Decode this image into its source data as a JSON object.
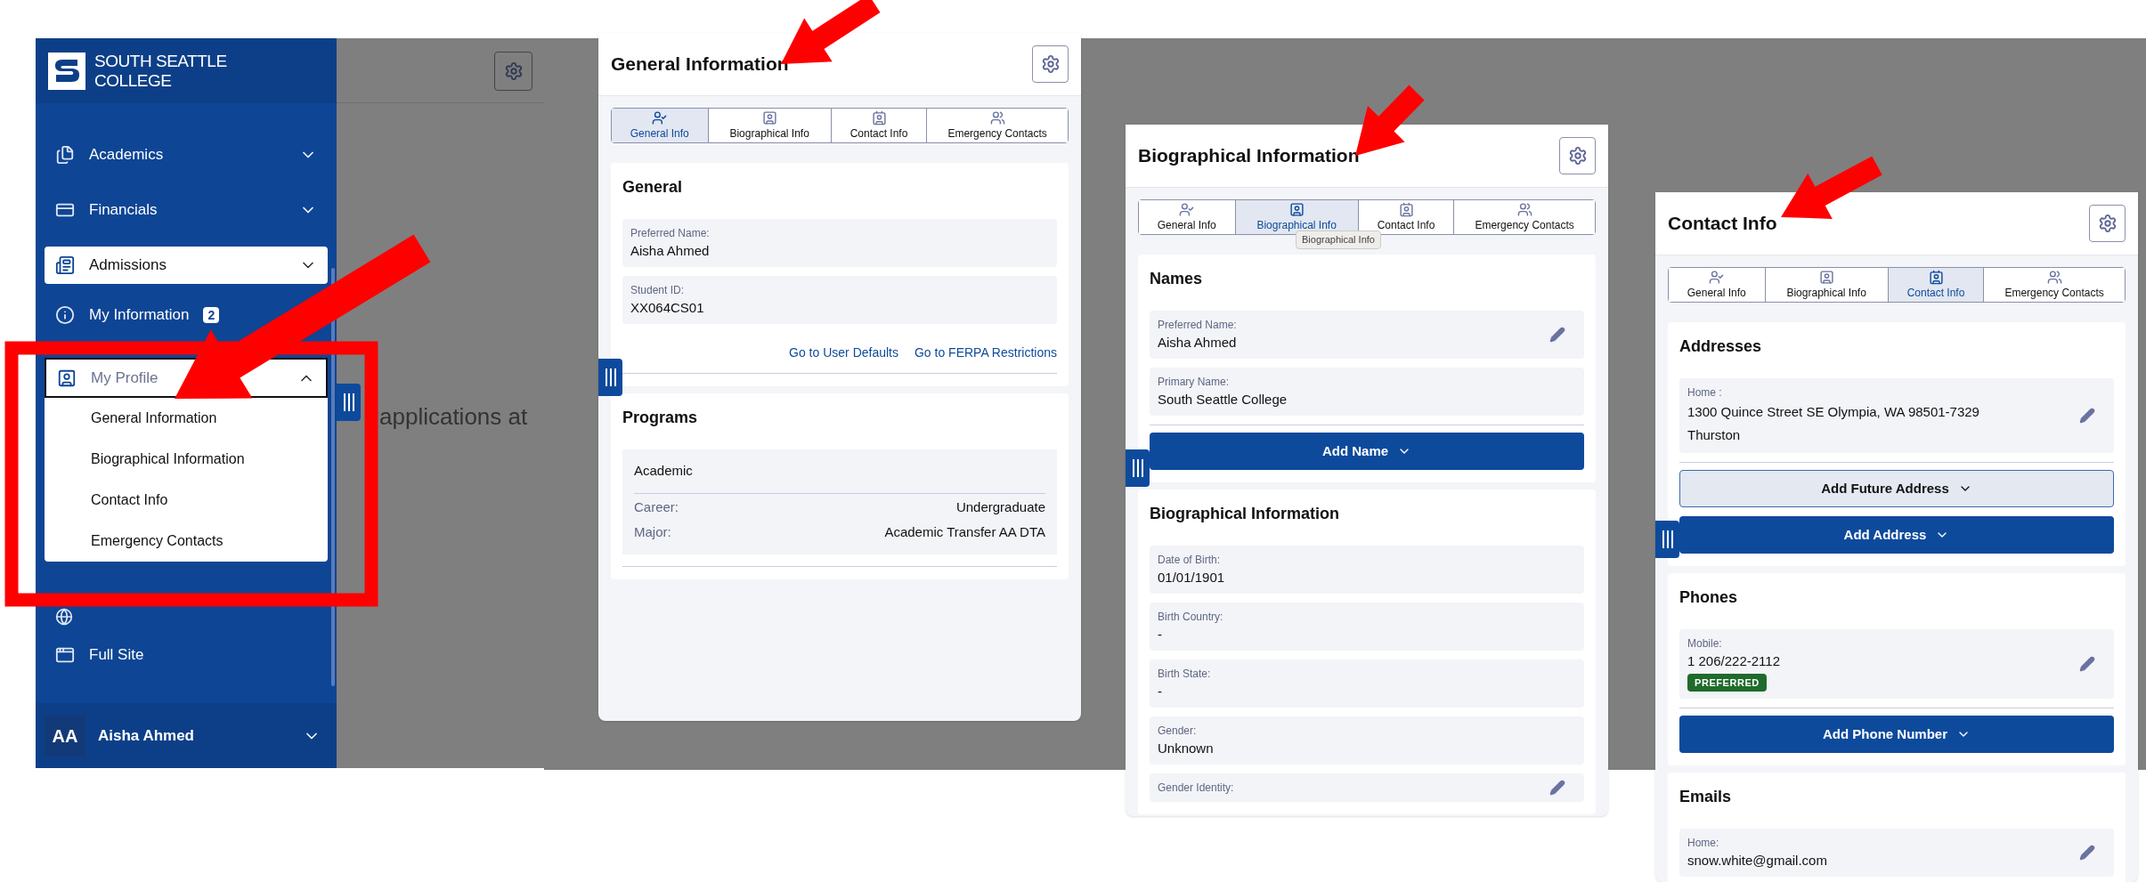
{
  "sidebar_screen": {
    "logo_lines": [
      "SOUTH SEATTLE",
      "COLLEGE"
    ],
    "nav": [
      {
        "label": "Academics",
        "selected": false,
        "expanded": false
      },
      {
        "label": "Financials",
        "selected": false,
        "expanded": false
      },
      {
        "label": "Admissions",
        "selected": true,
        "expanded": false
      },
      {
        "label": "My Information",
        "badge": "2",
        "selected": false
      },
      {
        "label": "My Profile",
        "selected": false,
        "expanded": true,
        "children": [
          {
            "label": "General Information"
          },
          {
            "label": "Biographical Information"
          },
          {
            "label": "Contact Info"
          },
          {
            "label": "Emergency Contacts"
          }
        ]
      },
      {
        "selected": false
      },
      {
        "label": "Full Site",
        "selected": false
      }
    ],
    "user": {
      "initials": "AA",
      "name": "Aisha Ahmed"
    },
    "content_text": "applications at"
  },
  "panels": [
    {
      "title": "General Information",
      "tabs": [
        {
          "label": "General Info",
          "selected": true
        },
        {
          "label": "Biographical Info",
          "selected": false
        },
        {
          "label": "Contact Info",
          "selected": false
        },
        {
          "label": "Emergency Contacts",
          "selected": false
        }
      ],
      "sections": [
        {
          "heading": "General",
          "items": [
            {
              "kind": "field",
              "label": "Preferred Name:",
              "value": "Aisha Ahmed",
              "editable": false
            },
            {
              "kind": "field",
              "label": "Student ID:",
              "value": "XX064CS01",
              "editable": false
            },
            {
              "kind": "links",
              "links": [
                "Go to User Defaults",
                "Go to FERPA Restrictions"
              ]
            }
          ]
        },
        {
          "heading": "Programs",
          "items": [
            {
              "kind": "program",
              "title": "Academic",
              "rows": [
                {
                  "label": "Career:",
                  "value": "Undergraduate"
                },
                {
                  "label": "Major:",
                  "value": "Academic Transfer AA DTA"
                }
              ]
            }
          ]
        }
      ]
    },
    {
      "title": "Biographical Information",
      "tooltip": "Biographical Info",
      "tabs": [
        {
          "label": "General Info",
          "selected": false
        },
        {
          "label": "Biographical Info",
          "selected": true
        },
        {
          "label": "Contact Info",
          "selected": false
        },
        {
          "label": "Emergency Contacts",
          "selected": false
        }
      ],
      "sections": [
        {
          "heading": "Names",
          "items": [
            {
              "kind": "field",
              "label": "Preferred Name:",
              "value": "Aisha Ahmed",
              "editable": true
            },
            {
              "kind": "field",
              "label": "Primary Name:",
              "value": "South Seattle College",
              "editable": false
            },
            {
              "kind": "button",
              "label": "Add Name"
            }
          ]
        },
        {
          "heading": "Biographical Information",
          "items": [
            {
              "kind": "field",
              "label": "Date of Birth:",
              "value": "01/01/1901",
              "editable": false
            },
            {
              "kind": "field",
              "label": "Birth Country:",
              "value": "-",
              "editable": false
            },
            {
              "kind": "field",
              "label": "Birth State:",
              "value": "-",
              "editable": false
            },
            {
              "kind": "field",
              "label": "Gender:",
              "value": "Unknown",
              "editable": false
            },
            {
              "kind": "field",
              "label": "Gender Identity:",
              "editable": true
            }
          ]
        }
      ]
    },
    {
      "title": "Contact Info",
      "tabs": [
        {
          "label": "General Info",
          "selected": false
        },
        {
          "label": "Biographical Info",
          "selected": false
        },
        {
          "label": "Contact Info",
          "selected": true
        },
        {
          "label": "Emergency Contacts",
          "selected": false
        }
      ],
      "sections": [
        {
          "heading": "Addresses",
          "items": [
            {
              "kind": "field",
              "label": "Home :",
              "lines": [
                "1300 Quince Street SE Olympia, WA 98501-7329",
                "Thurston"
              ],
              "editable": true
            },
            {
              "kind": "outline-button",
              "label": "Add Future Address"
            },
            {
              "kind": "button",
              "label": "Add Address"
            }
          ]
        },
        {
          "heading": "Phones",
          "items": [
            {
              "kind": "field",
              "label": "Mobile:",
              "value": "1 206/222-2112",
              "badge": "PREFERRED",
              "editable": true
            },
            {
              "kind": "button",
              "label": "Add Phone Number"
            }
          ]
        },
        {
          "heading": "Emails",
          "items": [
            {
              "kind": "field",
              "label": "Home:",
              "value": "snow.white@gmail.com",
              "editable": true
            }
          ]
        }
      ]
    }
  ]
}
